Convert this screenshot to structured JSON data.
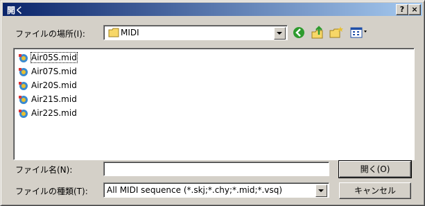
{
  "window": {
    "title": "開く"
  },
  "titlebar": {
    "help_label": "?",
    "close_label": "×"
  },
  "location": {
    "label": "ファイルの場所(I):",
    "value": "MIDI"
  },
  "files": [
    {
      "name": "Air05S.mid"
    },
    {
      "name": "Air07S.mid"
    },
    {
      "name": "Air20S.mid"
    },
    {
      "name": "Air21S.mid"
    },
    {
      "name": "Air22S.mid"
    }
  ],
  "filename": {
    "label": "ファイル名(N):",
    "value": ""
  },
  "filetype": {
    "label": "ファイルの種類(T):",
    "value": "All MIDI sequence (*.skj;*.chy;*.mid;*.vsq)"
  },
  "buttons": {
    "open": "開く(O)",
    "cancel": "キャンセル"
  },
  "icons": {
    "back": "back-icon",
    "up": "up-folder-icon",
    "new_folder": "new-folder-icon",
    "view": "view-menu-icon",
    "folder": "folder-icon",
    "file": "midi-file-icon"
  }
}
